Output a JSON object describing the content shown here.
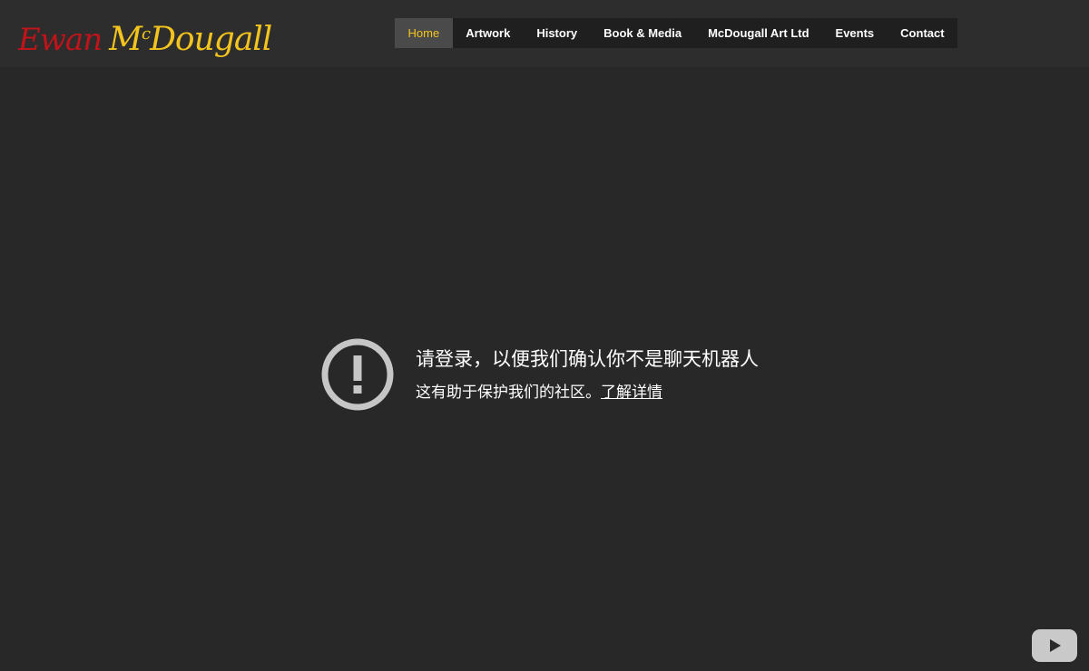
{
  "logo": {
    "first": "Ewan",
    "last_prefix": "M",
    "last_sup": "c",
    "last_rest": "Dougall",
    "first_color": "#c0141a",
    "last_color": "#f2c41d"
  },
  "nav": {
    "items": [
      {
        "label": "Home",
        "active": true
      },
      {
        "label": "Artwork"
      },
      {
        "label": "History"
      },
      {
        "label": "Book & Media"
      },
      {
        "label": "McDougall Art Ltd"
      },
      {
        "label": "Events"
      },
      {
        "label": "Contact"
      }
    ],
    "active_color": "#f2c41d"
  },
  "notice": {
    "icon": "alert-circle-icon",
    "title": "请登录，以便我们确认你不是聊天机器人",
    "subtitle": "这有助于保护我们的社区。",
    "link": "了解详情"
  },
  "player": {
    "icon": "play-icon"
  }
}
